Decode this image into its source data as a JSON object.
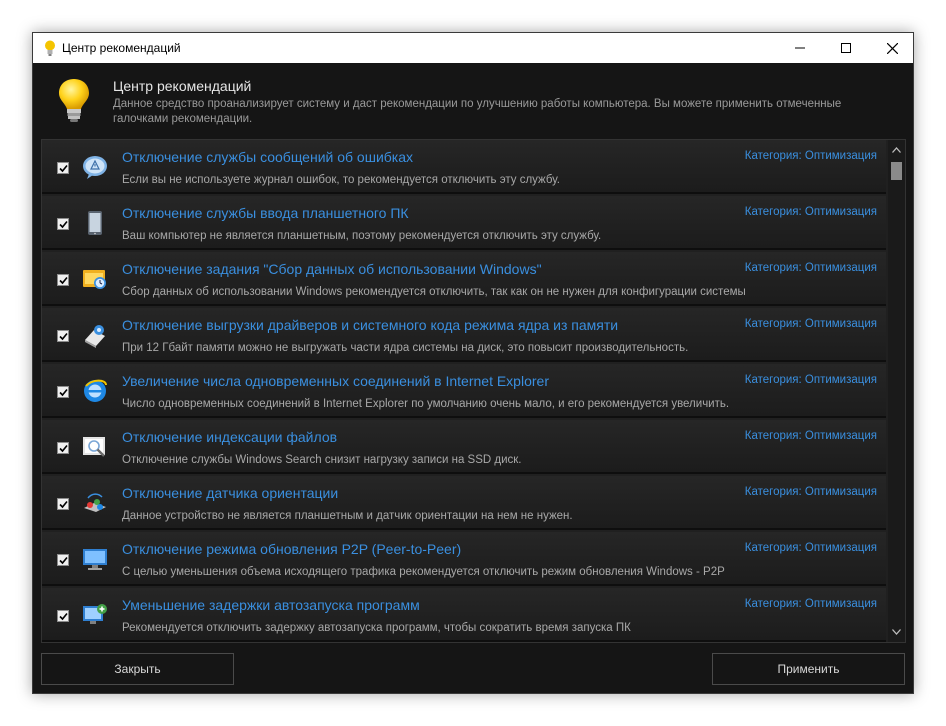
{
  "window": {
    "title": "Центр рекомендаций"
  },
  "header": {
    "title": "Центр рекомендаций",
    "description": "Данное средство проанализирует систему и даст рекомендации по улучшению работы компьютера. Вы можете применить отмеченные галочками рекомендации."
  },
  "items": [
    {
      "checked": true,
      "icon": "message-bubble-icon",
      "title": "Отключение службы сообщений об ошибках",
      "description": "Если вы не используете журнал ошибок, то рекомендуется отключить эту службу.",
      "category": "Категория: Оптимизация"
    },
    {
      "checked": true,
      "icon": "tablet-icon",
      "title": "Отключение службы ввода планшетного ПК",
      "description": "Ваш компьютер не является планшетным, поэтому рекомендуется отключить эту службу.",
      "category": "Категория: Оптимизация"
    },
    {
      "checked": true,
      "icon": "scheduled-task-icon",
      "title": "Отключение задания \"Сбор данных об использовании Windows\"",
      "description": "Сбор данных об использовании Windows рекомендуется отключить, так как он не нужен для конфигурации системы",
      "category": "Категория: Оптимизация"
    },
    {
      "checked": true,
      "icon": "driver-icon",
      "title": "Отключение выгрузки драйверов и системного кода режима ядра из памяти",
      "description": "При 12 Гбайт памяти можно не выгружать части ядра системы на диск, это повысит производительность.",
      "category": "Категория: Оптимизация"
    },
    {
      "checked": true,
      "icon": "internet-explorer-icon",
      "title": "Увеличение числа одновременных соединений в Internet Explorer",
      "description": "Число одновременных соединений в Internet Explorer по умолчанию очень мало, и его рекомендуется увеличить.",
      "category": "Категория: Оптимизация"
    },
    {
      "checked": true,
      "icon": "search-index-icon",
      "title": "Отключение индексации файлов",
      "description": "Отключение службы Windows Search снизит нагрузку записи на SSD диск.",
      "category": "Категория: Оптимизация"
    },
    {
      "checked": true,
      "icon": "orientation-sensor-icon",
      "title": "Отключение датчика ориентации",
      "description": "Данное устройство не является планшетным и датчик ориентации на нем не нужен.",
      "category": "Категория: Оптимизация"
    },
    {
      "checked": true,
      "icon": "network-monitor-icon",
      "title": "Отключение режима обновления P2P (Peer-to-Peer)",
      "description": "С целью уменьшения объема исходящего трафика рекомендуется отключить режим обновления Windows - P2P",
      "category": "Категория: Оптимизация"
    },
    {
      "checked": true,
      "icon": "startup-programs-icon",
      "title": "Уменьшение задержки автозапуска программ",
      "description": "Рекомендуется отключить задержку автозапуска программ, чтобы сократить время запуска ПК",
      "category": "Категория: Оптимизация"
    }
  ],
  "buttons": {
    "close": "Закрыть",
    "apply": "Применить"
  }
}
